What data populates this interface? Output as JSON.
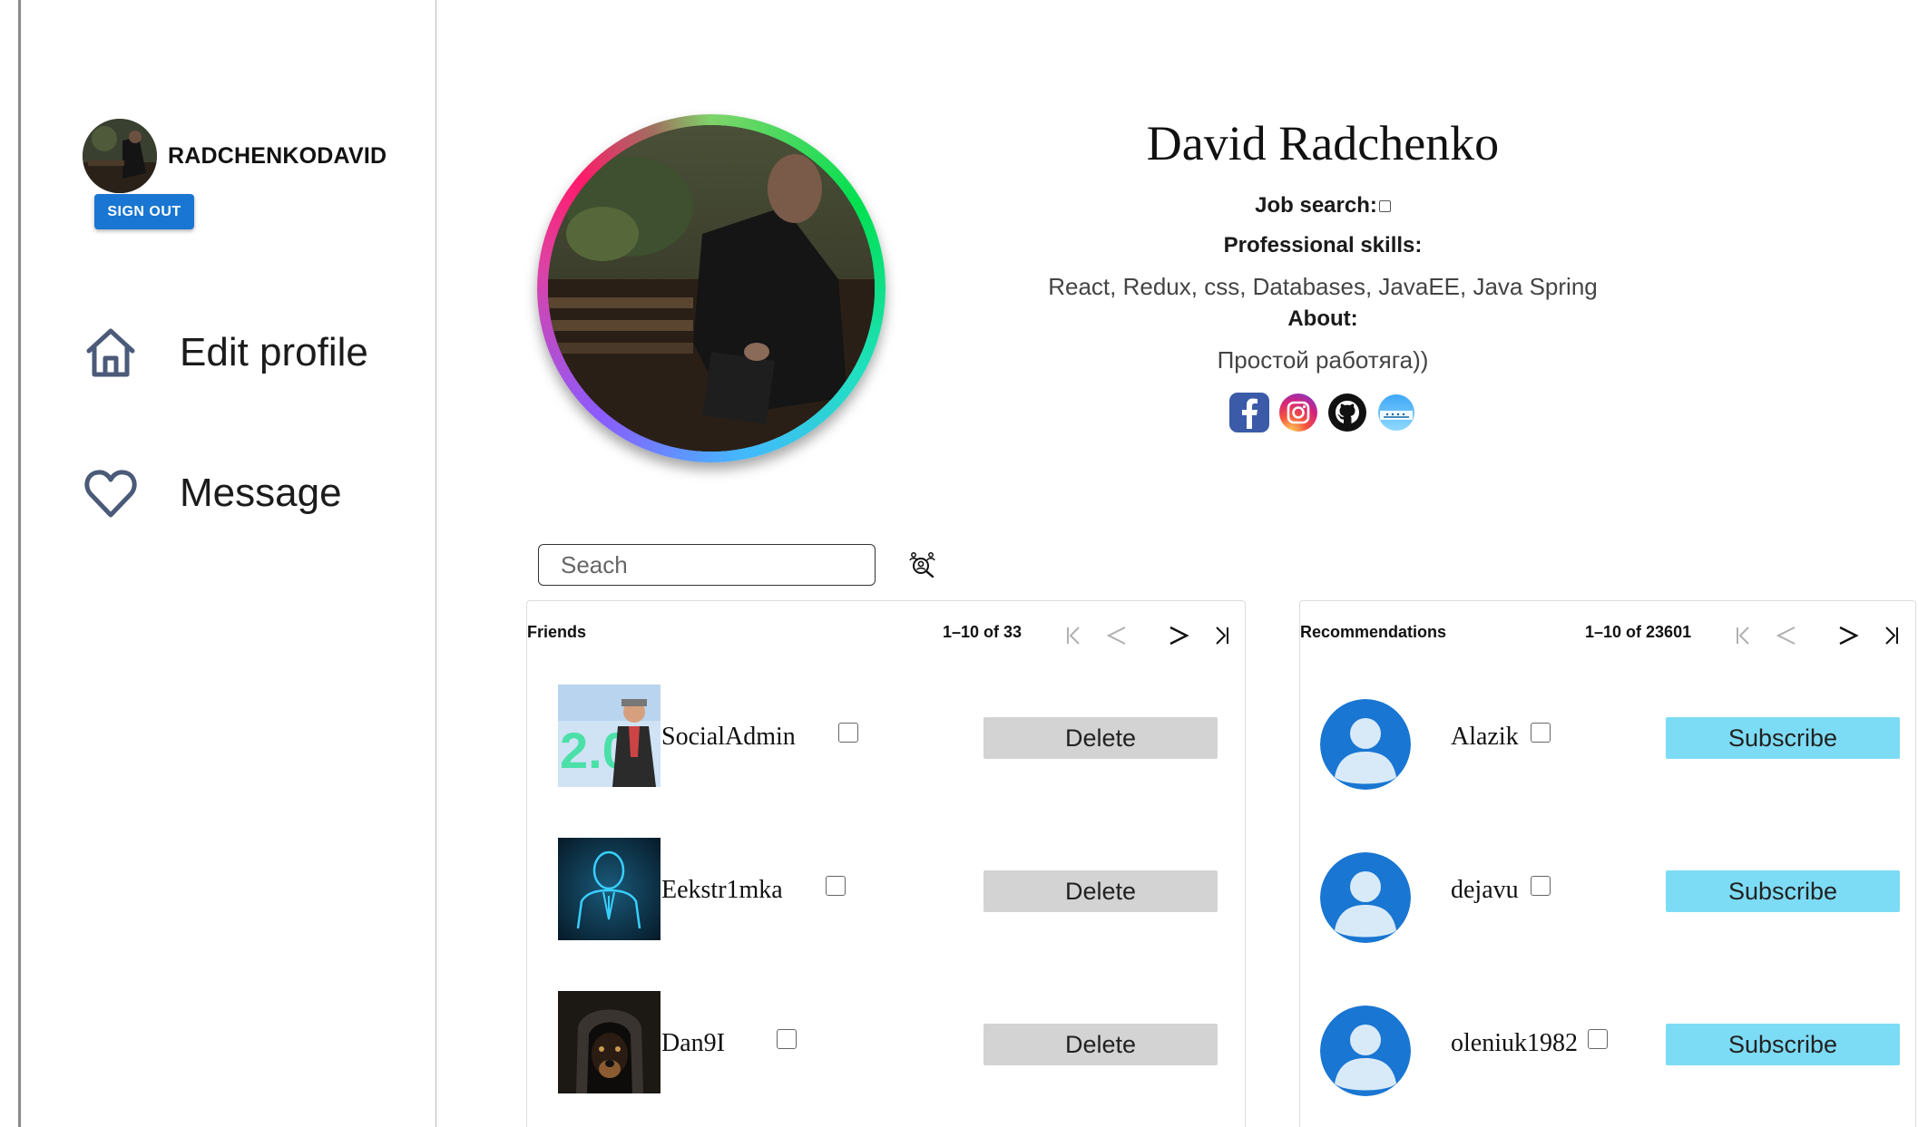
{
  "sidebar": {
    "username": "RADCHENKODAVID",
    "sign_out_label": "SIGN OUT",
    "nav": [
      {
        "label": "Edit profile",
        "icon": "home-icon"
      },
      {
        "label": "Message",
        "icon": "heart-icon"
      }
    ]
  },
  "profile": {
    "full_name": "David Radchenko",
    "job_search_label": "Job search:",
    "job_search_checked": false,
    "skills_label": "Professional skills:",
    "skills_value": "React, Redux, css, Databases, JavaEE, Java Spring",
    "about_label": "About:",
    "about_value": "Простой работяга))",
    "socials": [
      "facebook-icon",
      "instagram-icon",
      "github-icon",
      "website-icon"
    ]
  },
  "search": {
    "placeholder": "Seach",
    "value": ""
  },
  "friends": {
    "title": "Friends",
    "range": "1–10 of 33",
    "action_label": "Delete",
    "items": [
      {
        "name": "SocialAdmin"
      },
      {
        "name": "Eekstr1mka"
      },
      {
        "name": "Dan9I"
      }
    ]
  },
  "recommendations": {
    "title": "Recommendations",
    "range": "1–10 of 23601",
    "action_label": "Subscribe",
    "items": [
      {
        "name": "Alazik"
      },
      {
        "name": "dejavu"
      },
      {
        "name": "oleniuk1982"
      }
    ]
  },
  "colors": {
    "primary": "#1976d2",
    "subscribe": "#7ddcf5",
    "delete": "#d3d3d3",
    "default_avatar": "#1976d2"
  }
}
